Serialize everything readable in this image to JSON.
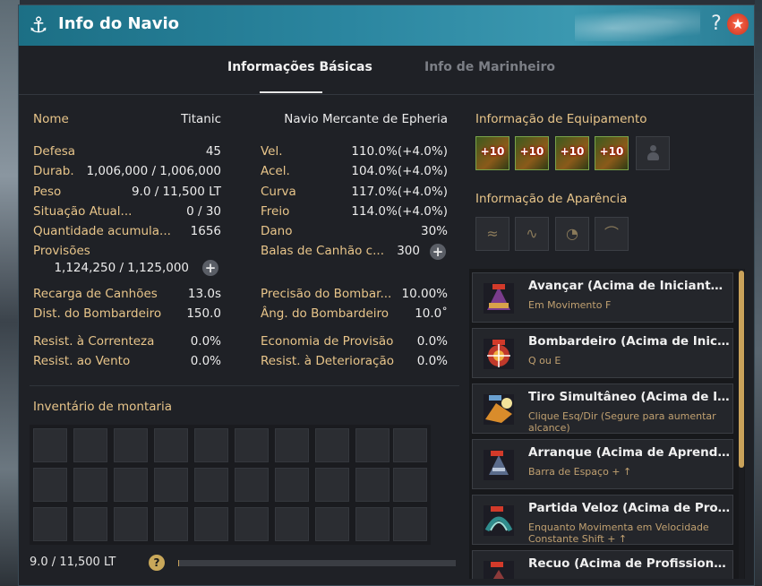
{
  "window": {
    "title": "Info do Navio",
    "anchor_icon": "⚓",
    "help_label": "?",
    "close_label": "★"
  },
  "tabs": [
    {
      "label": "Informações Básicas",
      "active": true
    },
    {
      "label": "Info de Marinheiro",
      "active": false
    }
  ],
  "ship": {
    "name_label": "Nome",
    "name_value": "Titanic",
    "type": "Navio Mercante de Epheria"
  },
  "stats_left": [
    {
      "label": "Defesa",
      "value": "45"
    },
    {
      "label": "Durab.",
      "value": "1,006,000 / 1,006,000"
    },
    {
      "label": "Peso",
      "value": "9.0 / 11,500 LT"
    },
    {
      "label": "Situação Atual...",
      "value": "0 / 30"
    },
    {
      "label": "Quantidade acumula...",
      "value": "1656"
    },
    {
      "label": "Provisões",
      "value": "1,124,250 / 1,125,000"
    },
    {
      "label": "Recarga de Canhões",
      "value": "13.0s"
    },
    {
      "label": "Dist. do Bombardeiro",
      "value": "150.0"
    },
    {
      "label": "Resist. à Correnteza",
      "value": "0.0%"
    },
    {
      "label": "Resist. ao Vento",
      "value": "0.0%"
    }
  ],
  "stats_right": [
    {
      "label": "Vel.",
      "value": "110.0%(+4.0%)"
    },
    {
      "label": "Acel.",
      "value": "104.0%(+4.0%)"
    },
    {
      "label": "Curva",
      "value": "117.0%(+4.0%)"
    },
    {
      "label": "Freio",
      "value": "114.0%(+4.0%)"
    },
    {
      "label": "Dano",
      "value": "30%"
    },
    {
      "label": "Balas de Canhão c...",
      "value": "300"
    },
    {
      "label": "Precisão do Bombar...",
      "value": "10.00%"
    },
    {
      "label": "Âng. do Bombardeiro",
      "value": "10.0˚"
    },
    {
      "label": "Economia de Provisão",
      "value": "0.0%"
    },
    {
      "label": "Resist. à Deterioração",
      "value": "0.0%"
    }
  ],
  "plus_symbol": "+",
  "inventory": {
    "title": "Inventário de montaria",
    "weight": "9.0 / 11,500 LT",
    "help": "?",
    "weight_fraction": 0.0008
  },
  "equipment": {
    "title": "Informação de Equipamento",
    "slots": [
      "+10",
      "+10",
      "+10",
      "+10"
    ]
  },
  "appearance": {
    "title": "Informação de Aparência",
    "slots": [
      "≈",
      "∿",
      "◔",
      "⌒"
    ]
  },
  "skills": [
    {
      "name": "Avançar (Acima de Iniciante Nv...",
      "desc": "Em Movimento F",
      "color": "#7a3c8c"
    },
    {
      "name": "Bombardeiro (Acima de Inician...",
      "desc": "Q ou E",
      "color": "#c0392b"
    },
    {
      "name": "Tiro Simultâneo (Acima de Inici...",
      "desc": "Clique Esq/Dir (Segure para aumentar alcance)",
      "color": "#d98c2b"
    },
    {
      "name": "Arranque (Acima de Aprendiz N...",
      "desc": "Barra de Espaço + ↑",
      "color": "#5a6b8c"
    },
    {
      "name": "Partida Veloz (Acima de Profici...",
      "desc": "Enquanto Movimenta em Velocidade Constante Shift + ↑",
      "color": "#2f8c8c"
    },
    {
      "name": "Recuo (Acima de Profissional N...",
      "desc": "",
      "color": "#8c3a3a"
    }
  ]
}
